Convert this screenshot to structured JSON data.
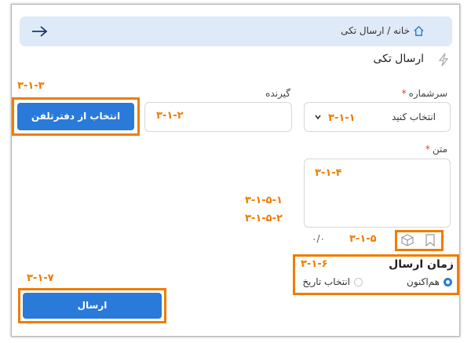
{
  "breadcrumb": {
    "path": "خانه / ارسال تکی"
  },
  "page": {
    "title": "ارسال تکی"
  },
  "form": {
    "line_label": "سرشماره",
    "line_required": "*",
    "line_value": "انتخاب کنید",
    "receiver_label": "گیرنده",
    "receiver_value": "",
    "text_label": "متن",
    "text_required": "*",
    "text_value": "",
    "counter": "۰/۰",
    "phonebook_button": "انتخاب از دفترتلفن",
    "send_button": "ارسال"
  },
  "schedule": {
    "title": "زمان ارسال",
    "options": [
      {
        "label": "هم‌اکنون",
        "selected": true
      },
      {
        "label": "انتخاب تاریخ",
        "selected": false
      }
    ]
  },
  "annotations": {
    "a311": "۳-۱-۱",
    "a312": "۳-۱-۲",
    "a313": "۳-۱-۳",
    "a314": "۳-۱-۴",
    "a315": "۳-۱-۵",
    "a3151": "۳-۱-۵-۱",
    "a3152": "۳-۱-۵-۲",
    "a316": "۳-۱-۶",
    "a317": "۳-۱-۷"
  },
  "colors": {
    "accent": "#2a7ad9",
    "annotation": "#ef7d00",
    "breadcrumb_bg": "#dfeaf8"
  }
}
